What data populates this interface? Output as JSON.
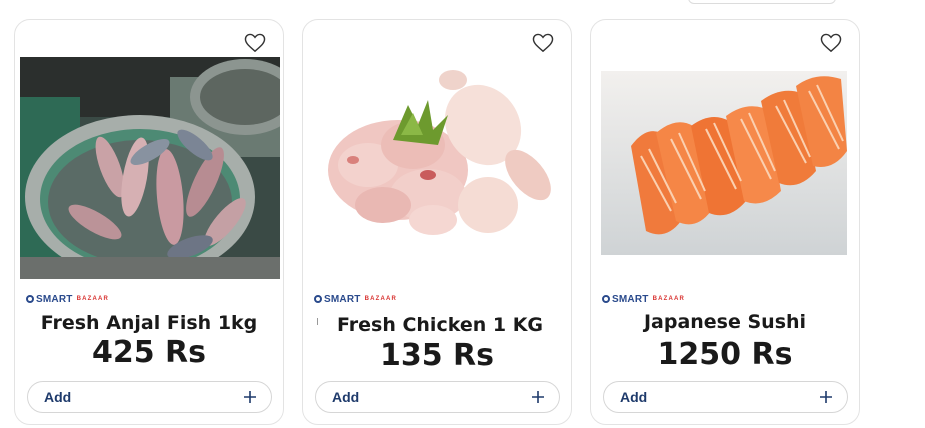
{
  "colors": {
    "brand_blue": "#2a4a8c",
    "brand_red": "#d8312f",
    "add_text": "#1e3a6b",
    "card_border": "#e3e3e3"
  },
  "products": [
    {
      "name": "Fresh Anjal Fish 1kg",
      "price": "425 Rs",
      "image_subject": "fish-in-steel-bowl",
      "brand": {
        "smart": "SMART",
        "bazaar": "BAZAAR"
      },
      "add_label": "Add",
      "wishlist_icon": "heart-outline-icon",
      "add_icon": "plus-icon"
    },
    {
      "name": "Fresh Chicken 1 KG",
      "price": "135 Rs",
      "image_subject": "raw-chicken-pieces",
      "brand": {
        "smart": "SMART",
        "bazaar": "BAZAAR"
      },
      "add_label": "Add",
      "wishlist_icon": "heart-outline-icon",
      "add_icon": "plus-icon"
    },
    {
      "name": "Japanese Sushi",
      "price": "1250 Rs",
      "image_subject": "salmon-sashimi-slices",
      "brand": {
        "smart": "SMART",
        "bazaar": "BAZAAR"
      },
      "add_label": "Add",
      "wishlist_icon": "heart-outline-icon",
      "add_icon": "plus-icon"
    }
  ]
}
